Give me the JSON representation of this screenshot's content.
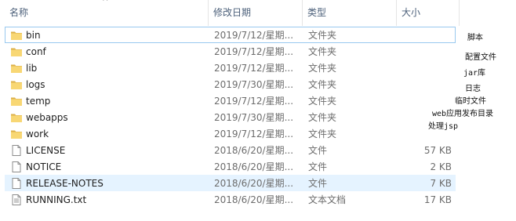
{
  "columns": {
    "name": "名称",
    "date": "修改日期",
    "type": "类型",
    "size": "大小"
  },
  "sort_arrow": "^",
  "files": [
    {
      "name": "bin",
      "date": "2019/7/12/星期...",
      "type": "文件夹",
      "size": "",
      "icon": "folder-icon"
    },
    {
      "name": "conf",
      "date": "2019/7/12/星期...",
      "type": "文件夹",
      "size": "",
      "icon": "folder-icon"
    },
    {
      "name": "lib",
      "date": "2019/7/12/星期...",
      "type": "文件夹",
      "size": "",
      "icon": "folder-icon"
    },
    {
      "name": "logs",
      "date": "2019/7/30/星期...",
      "type": "文件夹",
      "size": "",
      "icon": "folder-icon"
    },
    {
      "name": "temp",
      "date": "2019/7/12/星期...",
      "type": "文件夹",
      "size": "",
      "icon": "folder-icon"
    },
    {
      "name": "webapps",
      "date": "2019/7/30/星期...",
      "type": "文件夹",
      "size": "",
      "icon": "folder-icon"
    },
    {
      "name": "work",
      "date": "2019/7/12/星期...",
      "type": "文件夹",
      "size": "",
      "icon": "folder-icon"
    },
    {
      "name": "LICENSE",
      "date": "2018/6/20/星期...",
      "type": "文件",
      "size": "57 KB",
      "icon": "file-icon"
    },
    {
      "name": "NOTICE",
      "date": "2018/6/20/星期...",
      "type": "文件",
      "size": "2 KB",
      "icon": "file-icon"
    },
    {
      "name": "RELEASE-NOTES",
      "date": "2018/6/20/星期...",
      "type": "文件",
      "size": "7 KB",
      "icon": "file-icon"
    },
    {
      "name": "RUNNING.txt",
      "date": "2018/6/20/星期...",
      "type": "文本文档",
      "size": "17 KB",
      "icon": "text-file-icon"
    }
  ],
  "annotations": [
    "脚本",
    "配置文件",
    "jar库",
    "日志",
    "临时文件",
    "web应用发布目录",
    "处理jsp"
  ]
}
